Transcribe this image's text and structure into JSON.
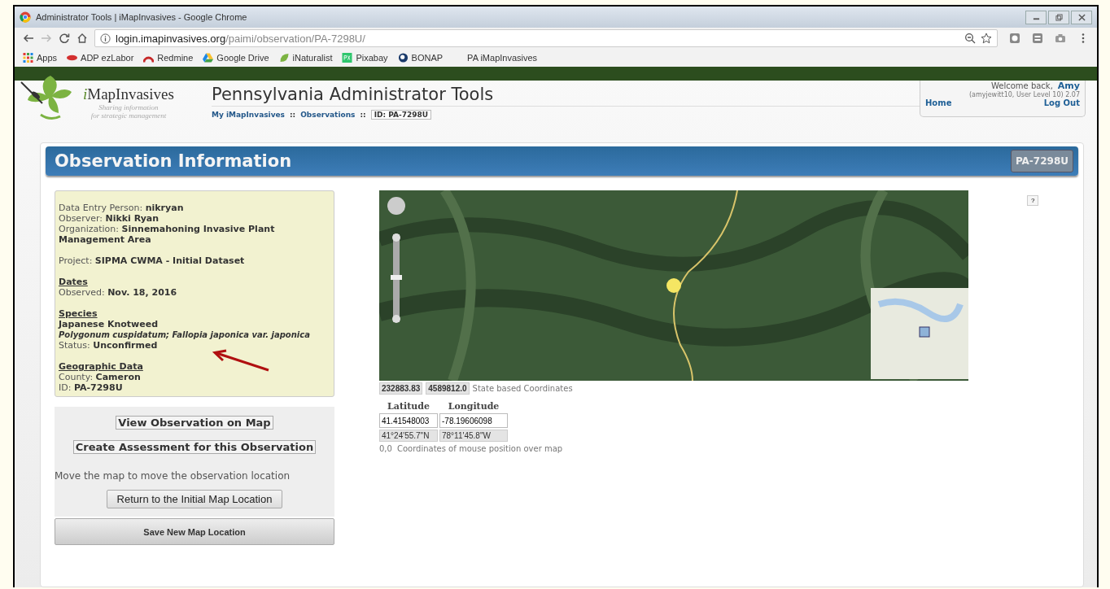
{
  "window": {
    "title": "Administrator Tools | iMapInvasives - Google Chrome",
    "url_host": "login.imapinvasives.org",
    "url_path": "/paimi/observation/PA-7298U/"
  },
  "bookmarks": [
    {
      "label": "Apps"
    },
    {
      "label": "ADP ezLabor"
    },
    {
      "label": "Redmine"
    },
    {
      "label": "Google Drive"
    },
    {
      "label": "iNaturalist"
    },
    {
      "label": "Pixabay"
    },
    {
      "label": "BONAP"
    },
    {
      "label": "PA iMapInvasives"
    }
  ],
  "header": {
    "logo_name": "iMapInvasives",
    "tagline": [
      "Sharing information",
      "for strategic management"
    ],
    "title": "Pennsylvania Administrator Tools",
    "breadcrumbs": [
      {
        "label": "My iMapInvasives",
        "kind": "link"
      },
      {
        "label": "::",
        "kind": "sep"
      },
      {
        "label": "Observations",
        "kind": "link"
      },
      {
        "label": "::",
        "kind": "sep"
      },
      {
        "label": "ID: PA-7298U",
        "kind": "current"
      }
    ]
  },
  "user_panel": {
    "welcome": "Welcome back,",
    "user": "Amy",
    "detail": "(amyjewitt10, User Level 10) 2.07",
    "home": "Home",
    "logout": "Log Out"
  },
  "panel": {
    "title": "Observation Information",
    "badge": "PA-7298U"
  },
  "info": [
    {
      "kind": "field",
      "label": "Data Entry Person:",
      "value": "nikryan"
    },
    {
      "kind": "field",
      "label": "Observer:",
      "value": "Nikki Ryan"
    },
    {
      "kind": "field",
      "label": "Organization:",
      "value": "Sinnemahoning Invasive Plant Management Area"
    },
    {
      "kind": "gap"
    },
    {
      "kind": "field",
      "label": "Project:",
      "value": "SIPMA CWMA - Initial Dataset"
    },
    {
      "kind": "gap"
    },
    {
      "kind": "heading",
      "text": "Dates"
    },
    {
      "kind": "field",
      "label": "Observed:",
      "value": "Nov. 18, 2016"
    },
    {
      "kind": "gap"
    },
    {
      "kind": "heading",
      "text": "Species"
    },
    {
      "kind": "strong",
      "text": "Japanese Knotweed"
    },
    {
      "kind": "italic",
      "text": "Polygonum cuspidatum; Fallopia japonica var. japonica"
    },
    {
      "kind": "field",
      "label": "Status:",
      "value": "Unconfirmed"
    },
    {
      "kind": "gap"
    },
    {
      "kind": "heading",
      "text": "Geographic Data"
    },
    {
      "kind": "field",
      "label": "County:",
      "value": "Cameron"
    },
    {
      "kind": "field",
      "label": "ID:",
      "value": "PA-7298U"
    }
  ],
  "actions": {
    "view_map": "View Observation on Map",
    "create_assessment": "Create Assessment for this Observation",
    "move_hint": "Move the map to move the observation location",
    "return_button": "Return to the Initial Map Location",
    "save_button": "Save New Map Location"
  },
  "help": "?",
  "coordinates": {
    "easting": "232883.83",
    "northing": "4589812.0",
    "state_label": "State based Coordinates",
    "lat_heading": "Latitude",
    "lon_heading": "Longitude",
    "lat": "41.41548003",
    "lon": "-78.19606098",
    "lat_dms": "41°24'55.7\"N",
    "lon_dms": "78°11'45.8\"W",
    "mouse": "0,0",
    "mouse_label": "Coordinates of mouse position over map"
  }
}
